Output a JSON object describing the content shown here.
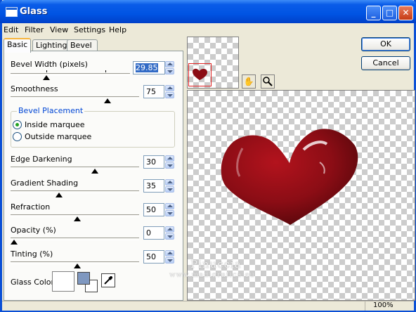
{
  "window": {
    "title": "Glass"
  },
  "menu": [
    "Edit",
    "Filter",
    "View",
    "Settings",
    "Help"
  ],
  "tabs": [
    "Basic",
    "Lighting",
    "Bevel Profile"
  ],
  "bevel_width": {
    "label": "Bevel Width (pixels)",
    "value": "29.85"
  },
  "smoothness": {
    "label": "Smoothness",
    "value": "75"
  },
  "bevel_placement": {
    "title": "Bevel Placement",
    "inside": "Inside marquee",
    "outside": "Outside marquee",
    "selected": "inside"
  },
  "edge_darkening": {
    "label": "Edge Darkening",
    "value": "30"
  },
  "gradient_shading": {
    "label": "Gradient Shading",
    "value": "35"
  },
  "refraction": {
    "label": "Refraction",
    "value": "50"
  },
  "opacity": {
    "label": "Opacity (%)",
    "value": "0"
  },
  "tinting": {
    "label": "Tinting (%)",
    "value": "50"
  },
  "glass_color": {
    "label": "Glass Color",
    "swatch": "#ffffff"
  },
  "buttons": {
    "ok": "OK",
    "cancel": "Cancel"
  },
  "icons": {
    "pan": "hand-icon",
    "zoom": "magnifier-icon",
    "eyedropper": "eyedropper-icon"
  },
  "colors": {
    "heart": "#8b0d15",
    "title_bar": "#0054e3"
  },
  "watermark": {
    "line1": "Pinuccia",
    "line2": "www.madigrafica.eu"
  },
  "status": {
    "zoom": "100%"
  }
}
